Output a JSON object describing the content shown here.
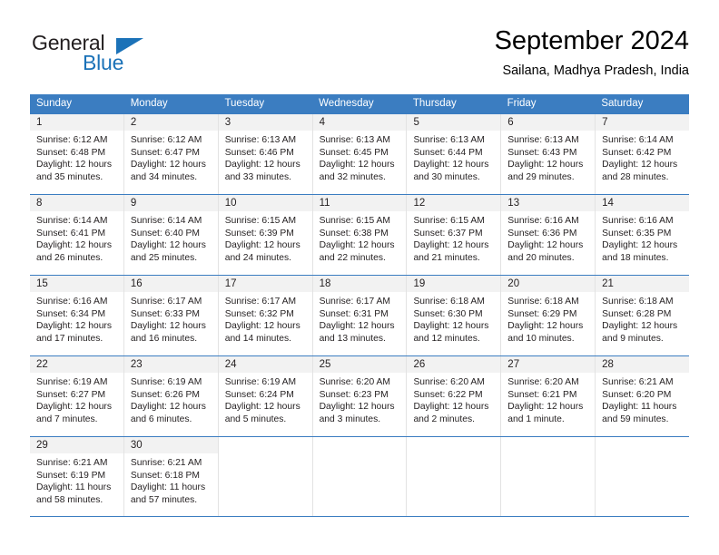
{
  "brand": {
    "name_primary": "General",
    "name_secondary": "Blue",
    "accent_color": "#1b72b8"
  },
  "header": {
    "title": "September 2024",
    "subtitle": "Sailana, Madhya Pradesh, India"
  },
  "theme": {
    "header_row_bg": "#3b7dc1",
    "daynum_band_bg": "#f2f2f2",
    "grid_line": "#e3e3e3",
    "text": "#231f20"
  },
  "weekdays": [
    "Sunday",
    "Monday",
    "Tuesday",
    "Wednesday",
    "Thursday",
    "Friday",
    "Saturday"
  ],
  "weeks": [
    [
      {
        "day": "1",
        "sunrise": "Sunrise: 6:12 AM",
        "sunset": "Sunset: 6:48 PM",
        "daylight": "Daylight: 12 hours and 35 minutes."
      },
      {
        "day": "2",
        "sunrise": "Sunrise: 6:12 AM",
        "sunset": "Sunset: 6:47 PM",
        "daylight": "Daylight: 12 hours and 34 minutes."
      },
      {
        "day": "3",
        "sunrise": "Sunrise: 6:13 AM",
        "sunset": "Sunset: 6:46 PM",
        "daylight": "Daylight: 12 hours and 33 minutes."
      },
      {
        "day": "4",
        "sunrise": "Sunrise: 6:13 AM",
        "sunset": "Sunset: 6:45 PM",
        "daylight": "Daylight: 12 hours and 32 minutes."
      },
      {
        "day": "5",
        "sunrise": "Sunrise: 6:13 AM",
        "sunset": "Sunset: 6:44 PM",
        "daylight": "Daylight: 12 hours and 30 minutes."
      },
      {
        "day": "6",
        "sunrise": "Sunrise: 6:13 AM",
        "sunset": "Sunset: 6:43 PM",
        "daylight": "Daylight: 12 hours and 29 minutes."
      },
      {
        "day": "7",
        "sunrise": "Sunrise: 6:14 AM",
        "sunset": "Sunset: 6:42 PM",
        "daylight": "Daylight: 12 hours and 28 minutes."
      }
    ],
    [
      {
        "day": "8",
        "sunrise": "Sunrise: 6:14 AM",
        "sunset": "Sunset: 6:41 PM",
        "daylight": "Daylight: 12 hours and 26 minutes."
      },
      {
        "day": "9",
        "sunrise": "Sunrise: 6:14 AM",
        "sunset": "Sunset: 6:40 PM",
        "daylight": "Daylight: 12 hours and 25 minutes."
      },
      {
        "day": "10",
        "sunrise": "Sunrise: 6:15 AM",
        "sunset": "Sunset: 6:39 PM",
        "daylight": "Daylight: 12 hours and 24 minutes."
      },
      {
        "day": "11",
        "sunrise": "Sunrise: 6:15 AM",
        "sunset": "Sunset: 6:38 PM",
        "daylight": "Daylight: 12 hours and 22 minutes."
      },
      {
        "day": "12",
        "sunrise": "Sunrise: 6:15 AM",
        "sunset": "Sunset: 6:37 PM",
        "daylight": "Daylight: 12 hours and 21 minutes."
      },
      {
        "day": "13",
        "sunrise": "Sunrise: 6:16 AM",
        "sunset": "Sunset: 6:36 PM",
        "daylight": "Daylight: 12 hours and 20 minutes."
      },
      {
        "day": "14",
        "sunrise": "Sunrise: 6:16 AM",
        "sunset": "Sunset: 6:35 PM",
        "daylight": "Daylight: 12 hours and 18 minutes."
      }
    ],
    [
      {
        "day": "15",
        "sunrise": "Sunrise: 6:16 AM",
        "sunset": "Sunset: 6:34 PM",
        "daylight": "Daylight: 12 hours and 17 minutes."
      },
      {
        "day": "16",
        "sunrise": "Sunrise: 6:17 AM",
        "sunset": "Sunset: 6:33 PM",
        "daylight": "Daylight: 12 hours and 16 minutes."
      },
      {
        "day": "17",
        "sunrise": "Sunrise: 6:17 AM",
        "sunset": "Sunset: 6:32 PM",
        "daylight": "Daylight: 12 hours and 14 minutes."
      },
      {
        "day": "18",
        "sunrise": "Sunrise: 6:17 AM",
        "sunset": "Sunset: 6:31 PM",
        "daylight": "Daylight: 12 hours and 13 minutes."
      },
      {
        "day": "19",
        "sunrise": "Sunrise: 6:18 AM",
        "sunset": "Sunset: 6:30 PM",
        "daylight": "Daylight: 12 hours and 12 minutes."
      },
      {
        "day": "20",
        "sunrise": "Sunrise: 6:18 AM",
        "sunset": "Sunset: 6:29 PM",
        "daylight": "Daylight: 12 hours and 10 minutes."
      },
      {
        "day": "21",
        "sunrise": "Sunrise: 6:18 AM",
        "sunset": "Sunset: 6:28 PM",
        "daylight": "Daylight: 12 hours and 9 minutes."
      }
    ],
    [
      {
        "day": "22",
        "sunrise": "Sunrise: 6:19 AM",
        "sunset": "Sunset: 6:27 PM",
        "daylight": "Daylight: 12 hours and 7 minutes."
      },
      {
        "day": "23",
        "sunrise": "Sunrise: 6:19 AM",
        "sunset": "Sunset: 6:26 PM",
        "daylight": "Daylight: 12 hours and 6 minutes."
      },
      {
        "day": "24",
        "sunrise": "Sunrise: 6:19 AM",
        "sunset": "Sunset: 6:24 PM",
        "daylight": "Daylight: 12 hours and 5 minutes."
      },
      {
        "day": "25",
        "sunrise": "Sunrise: 6:20 AM",
        "sunset": "Sunset: 6:23 PM",
        "daylight": "Daylight: 12 hours and 3 minutes."
      },
      {
        "day": "26",
        "sunrise": "Sunrise: 6:20 AM",
        "sunset": "Sunset: 6:22 PM",
        "daylight": "Daylight: 12 hours and 2 minutes."
      },
      {
        "day": "27",
        "sunrise": "Sunrise: 6:20 AM",
        "sunset": "Sunset: 6:21 PM",
        "daylight": "Daylight: 12 hours and 1 minute."
      },
      {
        "day": "28",
        "sunrise": "Sunrise: 6:21 AM",
        "sunset": "Sunset: 6:20 PM",
        "daylight": "Daylight: 11 hours and 59 minutes."
      }
    ],
    [
      {
        "day": "29",
        "sunrise": "Sunrise: 6:21 AM",
        "sunset": "Sunset: 6:19 PM",
        "daylight": "Daylight: 11 hours and 58 minutes."
      },
      {
        "day": "30",
        "sunrise": "Sunrise: 6:21 AM",
        "sunset": "Sunset: 6:18 PM",
        "daylight": "Daylight: 11 hours and 57 minutes."
      },
      {
        "day": "",
        "sunrise": "",
        "sunset": "",
        "daylight": ""
      },
      {
        "day": "",
        "sunrise": "",
        "sunset": "",
        "daylight": ""
      },
      {
        "day": "",
        "sunrise": "",
        "sunset": "",
        "daylight": ""
      },
      {
        "day": "",
        "sunrise": "",
        "sunset": "",
        "daylight": ""
      },
      {
        "day": "",
        "sunrise": "",
        "sunset": "",
        "daylight": ""
      }
    ]
  ]
}
